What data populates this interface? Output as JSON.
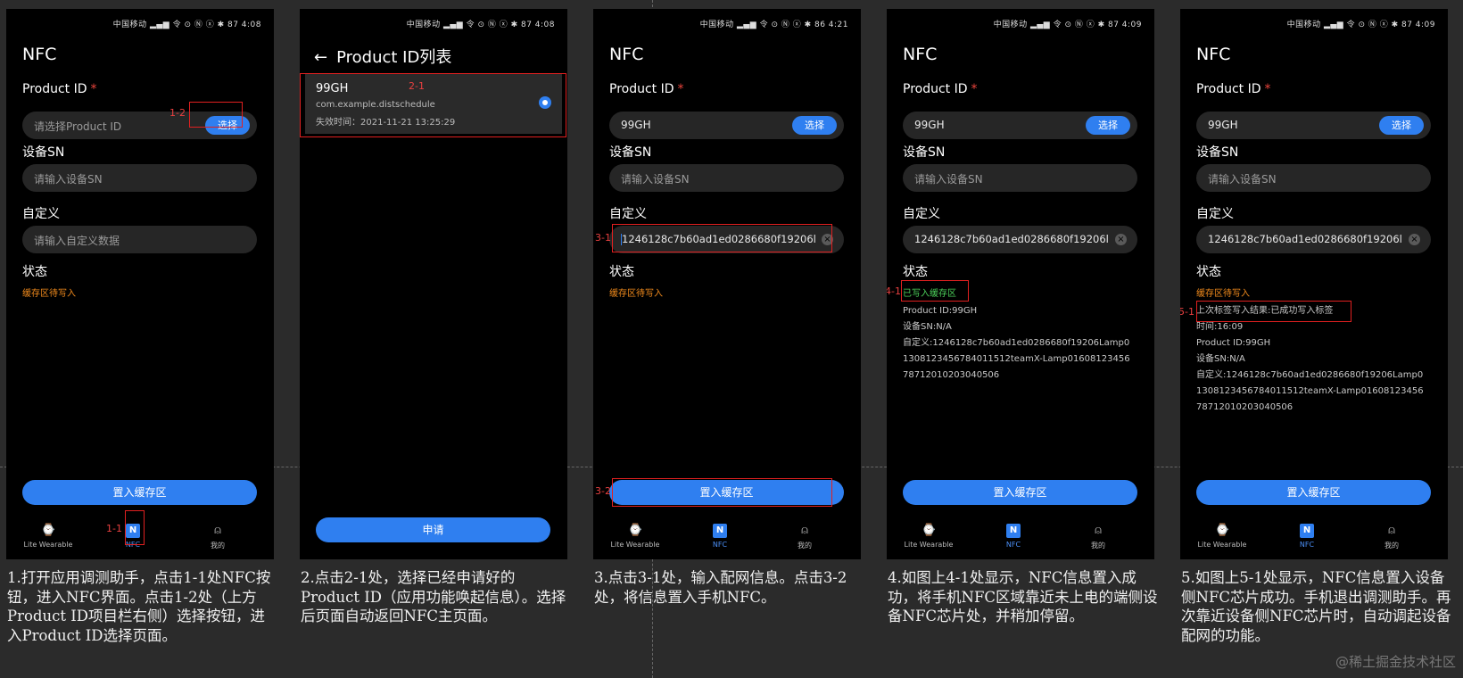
{
  "status_bar": [
    "中国移动 ▂▄▆ 令 ⊙ Ⓝ ⓧ ✱ 87 4:08",
    "中国移动 ▂▄▆ 令 ⊙ Ⓝ ⓧ ✱ 87 4:08",
    "中国移动 ▂▄▆ 令 ⊙ Ⓝ ⓧ ✱ 86 4:21",
    "中国移动 ▂▄▆ 令 ⊙ Ⓝ ⓧ ✱ 87 4:09",
    "中国移动 ▂▄▆ 令 ⊙ Ⓝ ⓧ ✱ 87 4:09"
  ],
  "nfc": {
    "title": "NFC",
    "product_id_label": "Product ID",
    "required_mark": "*",
    "product_id_placeholder": "请选择Product ID",
    "product_id_value": "99GH",
    "select_btn": "选择",
    "sn_label": "设备SN",
    "sn_placeholder": "请输入设备SN",
    "custom_label": "自定义",
    "custom_placeholder": "请输入自定义数据",
    "custom_value": "1246128c7b60ad1ed0286680f19206l",
    "status_label": "状态",
    "status_pending": "缓存区待写入",
    "status_written": "已写入缓存区",
    "last_write_result": "上次标签写入结果:已成功写入标签",
    "time": "时间:16:09",
    "pid_info": "Product ID:99GH",
    "sn_info": "设备SN:N/A",
    "custom_info": "自定义:1246128c7b60ad1ed0286680f19206Lamp01308123456784011512teamX-Lamp0160812345678712010203040506",
    "put_btn": "置入缓存区",
    "clear_icon": "×"
  },
  "tabs": {
    "t1": "Lite Wearable",
    "t2": "NFC",
    "t3": "我的"
  },
  "plist": {
    "back_icon": "←",
    "title": "Product ID列表",
    "item_name": "99GH",
    "item_pkg": "com.example.distschedule",
    "item_expiry": "失效时间：2021-11-21 13:25:29",
    "apply_btn": "申请"
  },
  "markers": {
    "m1_1": "1-1",
    "m1_2": "1-2",
    "m2_1": "2-1",
    "m3_1": "3-1",
    "m3_2": "3-2",
    "m4_1": "4-1",
    "m5_1": "5-1"
  },
  "captions": [
    "1.打开应用调测助手，点击1-1处NFC按钮，进入NFC界面。点击1-2处（上方Product ID项目栏右侧）选择按钮，进入Product ID选择页面。",
    "2.点击2-1处，选择已经申请好的Product ID（应用功能唤起信息）。选择后页面自动返回NFC主页面。",
    "3.点击3-1处，输入配网信息。点击3-2处，将信息置入手机NFC。",
    "4.如图上4-1处显示，NFC信息置入成功，将手机NFC区域靠近未上电的端侧设备NFC芯片处，并稍加停留。",
    "5.如图上5-1处显示，NFC信息置入设备侧NFC芯片成功。手机退出调测助手。再次靠近设备侧NFC芯片时，自动调起设备配网的功能。"
  ],
  "watermark": "@稀土掘金技术社区"
}
